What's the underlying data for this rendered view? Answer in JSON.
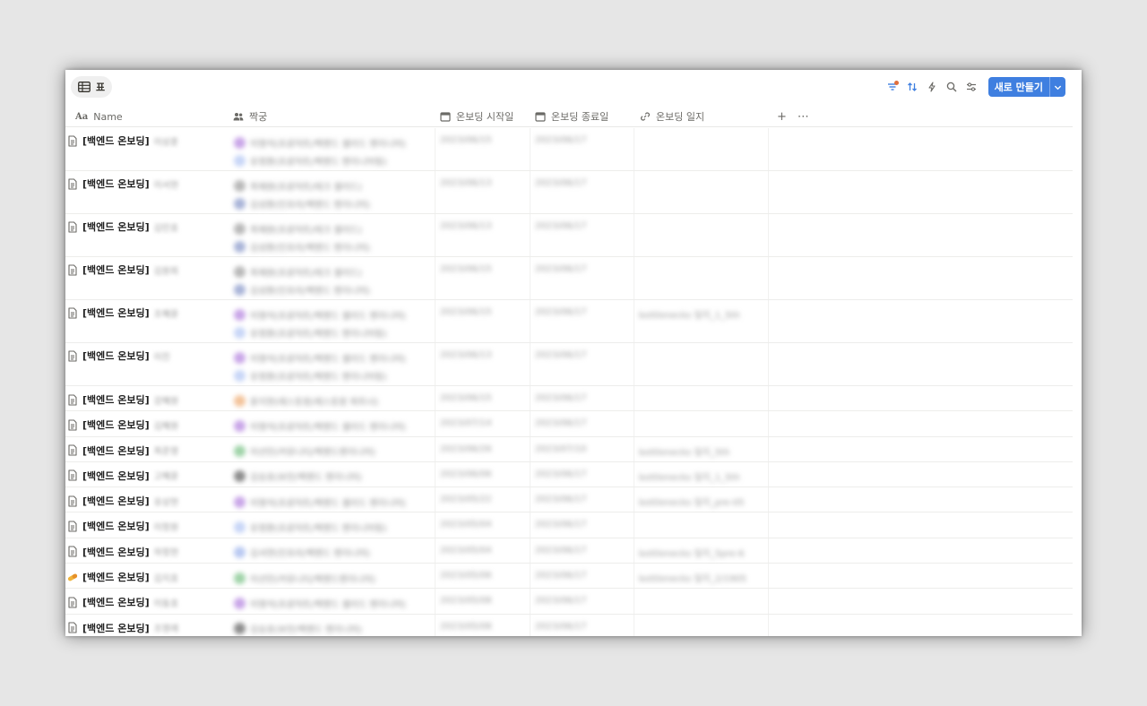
{
  "toolbar": {
    "view_tab_label": "표",
    "new_button_label": "새로 만들기"
  },
  "columns": {
    "name": "Name",
    "name_icon": "Aa",
    "buddy": "짝궁",
    "start": "온보딩 시작일",
    "end": "온보딩 종료일",
    "log": "온보딩 일지"
  },
  "rows": [
    {
      "title": "[백엔드 온보딩]",
      "icon": "page-icon",
      "person": "이상훈",
      "tall": true,
      "buddies": [
        {
          "name": "이영석(프로덕트/백엔드 셀리드 엔지니어)",
          "color": "#c9a6e8"
        },
        {
          "name": "유정환(프로덕트/백엔드 엔지니어링)",
          "color": "#c8d6f7"
        }
      ],
      "start": "2023/06/15",
      "end": "2023/06/17",
      "log": ""
    },
    {
      "title": "[백엔드 온보딩]",
      "icon": "page-icon",
      "person": "이서현",
      "tall": true,
      "buddies": [
        {
          "name": "최재원(프로덕트/테크 셀리드)",
          "color": "#b9b9b9"
        },
        {
          "name": "김성환(인프라/백엔드 엔지니어)",
          "color": "#a9b4d8"
        }
      ],
      "start": "2023/06/13",
      "end": "2023/06/17",
      "log": ""
    },
    {
      "title": "[백엔드 온보딩]",
      "icon": "page-icon",
      "person": "김민호",
      "tall": true,
      "buddies": [
        {
          "name": "최재원(프로덕트/테크 셀리드)",
          "color": "#b9b9b9"
        },
        {
          "name": "김성환(인프라/백엔드 엔지니어)",
          "color": "#a9b4d8"
        }
      ],
      "start": "2023/06/13",
      "end": "2023/06/17",
      "log": ""
    },
    {
      "title": "[백엔드 온보딩]",
      "icon": "page-icon",
      "person": "김원희",
      "tall": true,
      "buddies": [
        {
          "name": "최재원(프로덕트/테크 셀리드)",
          "color": "#b9b9b9"
        },
        {
          "name": "김성환(인프라/백엔드 엔지니어)",
          "color": "#a9b4d8"
        }
      ],
      "start": "2023/06/15",
      "end": "2023/06/17",
      "log": ""
    },
    {
      "title": "[백엔드 온보딩]",
      "icon": "page-icon",
      "person": "조혜윤",
      "tall": true,
      "buddies": [
        {
          "name": "이영석(프로덕트/백엔드 셀리드 엔지니어)",
          "color": "#c9a6e8"
        },
        {
          "name": "유정환(프로덕트/백엔드 엔지니어링)",
          "color": "#c8d6f7"
        }
      ],
      "start": "2023/06/15",
      "end": "2023/06/17",
      "log": "bottlenecks 일지_1_5th"
    },
    {
      "title": "[백엔드 온보딩]",
      "icon": "page-icon",
      "person": "이진",
      "tall": true,
      "buddies": [
        {
          "name": "이영석(프로덕트/백엔드 셀리드 엔지니어)",
          "color": "#c9a6e8"
        },
        {
          "name": "유정환(프로덕트/백엔드 엔지니어링)",
          "color": "#c8d6f7"
        }
      ],
      "start": "2023/06/13",
      "end": "2023/06/17",
      "log": ""
    },
    {
      "title": "[백엔드 온보딩]",
      "icon": "page-icon",
      "person": "강혜원",
      "tall": false,
      "buddies": [
        {
          "name": "윤지현(레스토랑/레스토랑 파트너)",
          "color": "#f3c39a"
        }
      ],
      "start": "2023/06/15",
      "end": "2023/06/17",
      "log": ""
    },
    {
      "title": "[백엔드 온보딩]",
      "icon": "page-icon",
      "person": "김혜원",
      "tall": false,
      "buddies": [
        {
          "name": "이영석(프로덕트/백엔드 셀리드 엔지니어)",
          "color": "#c9a6e8"
        }
      ],
      "start": "2023/07/14",
      "end": "2023/06/17",
      "log": ""
    },
    {
      "title": "[백엔드 온보딩]",
      "icon": "page-icon",
      "person": "최준영",
      "tall": false,
      "buddies": [
        {
          "name": "이선민(커뮤니티/백엔드엔지니어)",
          "color": "#9fd3a8"
        }
      ],
      "start": "2023/06/26",
      "end": "2023/07/10",
      "log": "bottlenecks 일지_5th"
    },
    {
      "title": "[백엔드 온보딩]",
      "icon": "page-icon",
      "person": "고혜윤",
      "tall": false,
      "buddies": [
        {
          "name": "김승호(보안/백엔드 엔지니어)",
          "color": "#8c8c8c"
        }
      ],
      "start": "2023/06/06",
      "end": "2023/06/17",
      "log": "bottlenecks 일지_1_5th"
    },
    {
      "title": "[백엔드 온보딩]",
      "icon": "page-icon",
      "person": "유상현",
      "tall": false,
      "buddies": [
        {
          "name": "이영석(프로덕트/백엔드 셀리드 엔지니어)",
          "color": "#c9a6e8"
        }
      ],
      "start": "2023/05/22",
      "end": "2023/06/17",
      "log": "bottlenecks 일지_pre-05"
    },
    {
      "title": "[백엔드 온보딩]",
      "icon": "page-icon",
      "person": "이정원",
      "tall": false,
      "buddies": [
        {
          "name": "유정환(프로덕트/백엔드 엔지니어링)",
          "color": "#c8d6f7"
        }
      ],
      "start": "2023/05/04",
      "end": "2023/06/17",
      "log": ""
    },
    {
      "title": "[백엔드 온보딩]",
      "icon": "page-icon",
      "person": "하정현",
      "tall": false,
      "buddies": [
        {
          "name": "김서연(인프라/백엔드 엔지니어)",
          "color": "#b9c9f2"
        }
      ],
      "start": "2023/05/04",
      "end": "2023/06/17",
      "log": "bottlenecks 일지_5pre-6"
    },
    {
      "title": "[백엔드 온보딩]",
      "icon": "pill-icon",
      "person": "김지호",
      "tall": false,
      "buddies": [
        {
          "name": "이선민(커뮤니티/백엔드엔지니어)",
          "color": "#9fd3a8"
        }
      ],
      "start": "2023/05/06",
      "end": "2023/06/17",
      "log": "bottlenecks 일지_2/1905"
    },
    {
      "title": "[백엔드 온보딩]",
      "icon": "page-icon",
      "person": "이동호",
      "tall": false,
      "buddies": [
        {
          "name": "이영석(프로덕트/백엔드 셀리드 엔지니어)",
          "color": "#c9a6e8"
        }
      ],
      "start": "2023/05/08",
      "end": "2023/06/17",
      "log": ""
    },
    {
      "title": "[백엔드 온보딩]",
      "icon": "page-icon",
      "person": "조영래",
      "tall": false,
      "buddies": [
        {
          "name": "김승호(보안/백엔드 엔지니어)",
          "color": "#8c8c8c"
        }
      ],
      "start": "2023/05/08",
      "end": "2023/06/17",
      "log": ""
    }
  ]
}
